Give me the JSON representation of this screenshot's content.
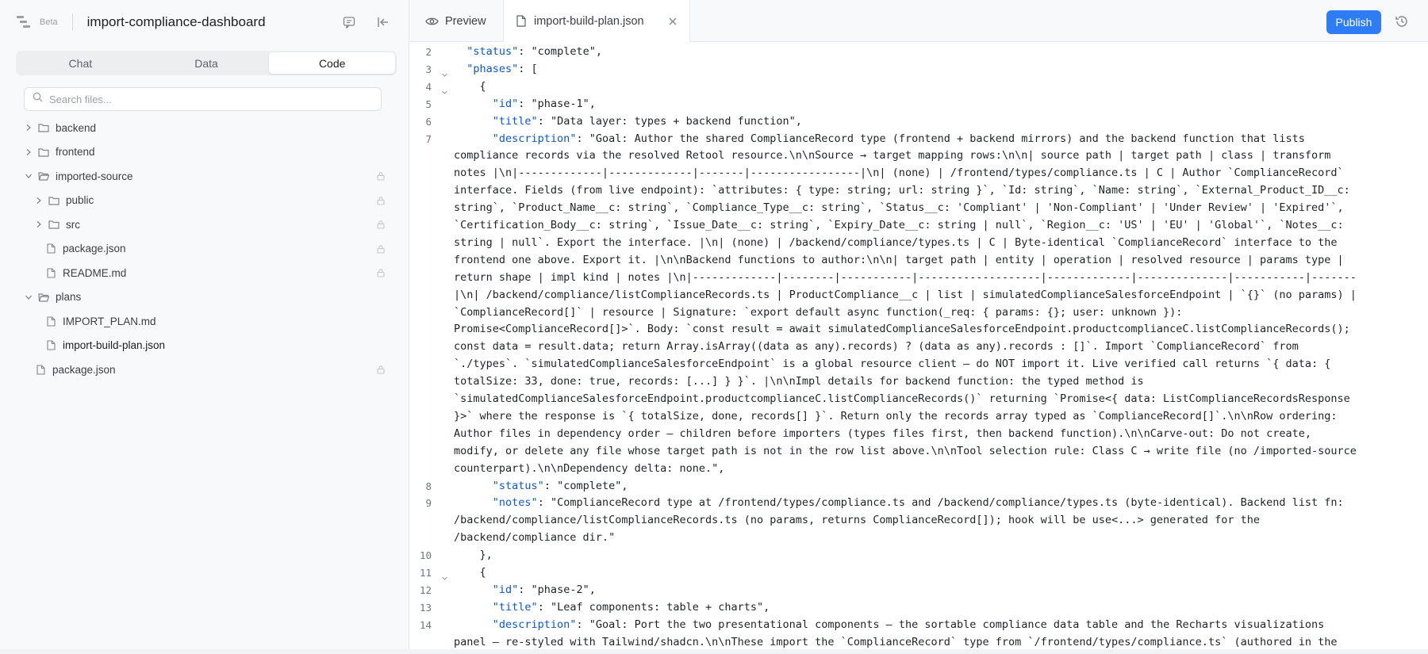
{
  "sidebar": {
    "beta_label": "Beta",
    "project_name": "import-compliance-dashboard",
    "tabs": [
      {
        "label": "Chat",
        "active": false
      },
      {
        "label": "Data",
        "active": false
      },
      {
        "label": "Code",
        "active": true
      }
    ],
    "search": {
      "placeholder": "Search files..."
    },
    "tree": [
      {
        "label": "backend",
        "type": "folder",
        "expanded": false,
        "depth": 0,
        "locked": false
      },
      {
        "label": "frontend",
        "type": "folder",
        "expanded": false,
        "depth": 0,
        "locked": false
      },
      {
        "label": "imported-source",
        "type": "folder",
        "expanded": true,
        "depth": 0,
        "locked": true
      },
      {
        "label": "public",
        "type": "folder",
        "expanded": false,
        "depth": 1,
        "locked": true
      },
      {
        "label": "src",
        "type": "folder",
        "expanded": false,
        "depth": 1,
        "locked": true
      },
      {
        "label": "package.json",
        "type": "file",
        "depth": 1,
        "locked": true
      },
      {
        "label": "README.md",
        "type": "file",
        "depth": 1,
        "locked": true
      },
      {
        "label": "plans",
        "type": "folder",
        "expanded": true,
        "depth": 0,
        "locked": false
      },
      {
        "label": "IMPORT_PLAN.md",
        "type": "file",
        "depth": 1,
        "locked": false
      },
      {
        "label": "import-build-plan.json",
        "type": "file",
        "depth": 1,
        "locked": false,
        "selected": true
      },
      {
        "label": "package.json",
        "type": "file",
        "depth": 0,
        "locked": true
      }
    ]
  },
  "editor": {
    "preview_tab": "Preview",
    "file_tab": "import-build-plan.json",
    "publish_label": "Publish"
  },
  "code": {
    "lines": [
      {
        "n": "2",
        "fold": false,
        "text": "  \"status\": \"complete\","
      },
      {
        "n": "3",
        "fold": true,
        "text": "  \"phases\": ["
      },
      {
        "n": "4",
        "fold": true,
        "text": "    {"
      },
      {
        "n": "5",
        "fold": false,
        "text": "      \"id\": \"phase-1\","
      },
      {
        "n": "6",
        "fold": false,
        "text": "      \"title\": \"Data layer: types + backend function\","
      },
      {
        "n": "7",
        "fold": false,
        "text": "      \"description\": \"Goal: Author the shared ComplianceRecord type (frontend + backend mirrors) and the backend function that lists"
      },
      {
        "n": "",
        "fold": false,
        "text": "compliance records via the resolved Retool resource.\\n\\nSource → target mapping rows:\\n\\n| source path | target path | class | transform"
      },
      {
        "n": "",
        "fold": false,
        "text": "notes |\\n|-------------|-------------|-------|-----------------|\\n| (none) | /frontend/types/compliance.ts | C | Author `ComplianceRecord`"
      },
      {
        "n": "",
        "fold": false,
        "text": "interface. Fields (from live endpoint): `attributes: { type: string; url: string }`, `Id: string`, `Name: string`, `External_Product_ID__c:"
      },
      {
        "n": "",
        "fold": false,
        "text": "string`, `Product_Name__c: string`, `Compliance_Type__c: string`, `Status__c: 'Compliant' | 'Non-Compliant' | 'Under Review' | 'Expired'`,"
      },
      {
        "n": "",
        "fold": false,
        "text": "`Certification_Body__c: string`, `Issue_Date__c: string`, `Expiry_Date__c: string | null`, `Region__c: 'US' | 'EU' | 'Global'`, `Notes__c:"
      },
      {
        "n": "",
        "fold": false,
        "text": "string | null`. Export the interface. |\\n| (none) | /backend/compliance/types.ts | C | Byte-identical `ComplianceRecord` interface to the"
      },
      {
        "n": "",
        "fold": false,
        "text": "frontend one above. Export it. |\\n\\nBackend functions to author:\\n\\n| target path | entity | operation | resolved resource | params type |"
      },
      {
        "n": "",
        "fold": false,
        "text": "return shape | impl kind | notes |\\n|-------------|--------|-----------|-------------------|-------------|--------------|-----------|-------"
      },
      {
        "n": "",
        "fold": false,
        "text": "|\\n| /backend/compliance/listComplianceRecords.ts | ProductCompliance__c | list | simulatedComplianceSalesforceEndpoint | `{}` (no params) |"
      },
      {
        "n": "",
        "fold": false,
        "text": "`ComplianceRecord[]` | resource | Signature: `export default async function(_req: { params: {}; user: unknown }):"
      },
      {
        "n": "",
        "fold": false,
        "text": "Promise<ComplianceRecord[]>`. Body: `const result = await simulatedComplianceSalesforceEndpoint.productcomplianceC.listComplianceRecords();"
      },
      {
        "n": "",
        "fold": false,
        "text": "const data = result.data; return Array.isArray((data as any).records) ? (data as any).records : []`. Import `ComplianceRecord` from"
      },
      {
        "n": "",
        "fold": false,
        "text": "`./types`. `simulatedComplianceSalesforceEndpoint` is a global resource client — do NOT import it. Live verified call returns `{ data: {"
      },
      {
        "n": "",
        "fold": false,
        "text": "totalSize: 33, done: true, records: [...] } }`. |\\n\\nImpl details for backend function: the typed method is"
      },
      {
        "n": "",
        "fold": false,
        "text": "`simulatedComplianceSalesforceEndpoint.productcomplianceC.listComplianceRecords()` returning `Promise<{ data: ListComplianceRecordsResponse"
      },
      {
        "n": "",
        "fold": false,
        "text": "}>` where the response is `{ totalSize, done, records[] }`. Return only the records array typed as `ComplianceRecord[]`.\\n\\nRow ordering:"
      },
      {
        "n": "",
        "fold": false,
        "text": "Author files in dependency order — children before importers (types files first, then backend function).\\n\\nCarve-out: Do not create,"
      },
      {
        "n": "",
        "fold": false,
        "text": "modify, or delete any file whose target path is not in the row list above.\\n\\nTool selection rule: Class C → write file (no /imported-source"
      },
      {
        "n": "",
        "fold": false,
        "text": "counterpart).\\n\\nDependency delta: none.\","
      },
      {
        "n": "8",
        "fold": false,
        "text": "      \"status\": \"complete\","
      },
      {
        "n": "9",
        "fold": false,
        "text": "      \"notes\": \"ComplianceRecord type at /frontend/types/compliance.ts and /backend/compliance/types.ts (byte-identical). Backend list fn:"
      },
      {
        "n": "",
        "fold": false,
        "text": "/backend/compliance/listComplianceRecords.ts (no params, returns ComplianceRecord[]); hook will be use<...> generated for the"
      },
      {
        "n": "",
        "fold": false,
        "text": "/backend/compliance dir.\""
      },
      {
        "n": "10",
        "fold": false,
        "text": "    },"
      },
      {
        "n": "11",
        "fold": true,
        "text": "    {"
      },
      {
        "n": "12",
        "fold": false,
        "text": "      \"id\": \"phase-2\","
      },
      {
        "n": "13",
        "fold": false,
        "text": "      \"title\": \"Leaf components: table + charts\","
      },
      {
        "n": "14",
        "fold": false,
        "text": "      \"description\": \"Goal: Port the two presentational components — the sortable compliance data table and the Recharts visualizations"
      },
      {
        "n": "",
        "fold": false,
        "text": "panel — re-styled with Tailwind/shadcn.\\n\\nThese import the `ComplianceRecord` type from `/frontend/types/compliance.ts` (authored in the"
      }
    ]
  },
  "colors": {
    "accent": "#2f7df6",
    "json_key": "#0b57d0",
    "sidebar_bg": "#f8f9fa"
  },
  "icons": [
    "logo-icon",
    "chat-icon",
    "collapse-sidebar-icon",
    "search-icon",
    "chevron-right-icon",
    "chevron-down-icon",
    "folder-icon",
    "file-icon",
    "lock-icon",
    "eye-icon",
    "close-icon",
    "history-icon"
  ]
}
